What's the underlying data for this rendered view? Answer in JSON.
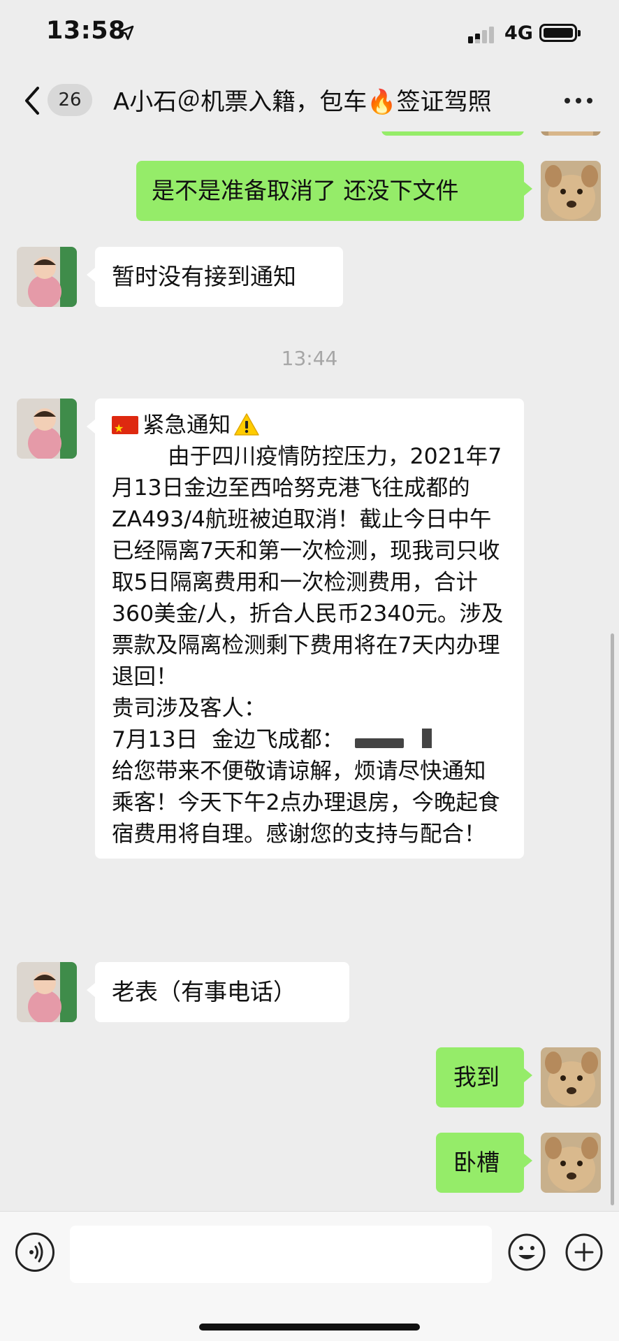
{
  "status_bar": {
    "time": "13:58",
    "network": "4G",
    "icons": [
      "location-arrow-icon",
      "cellular-signal-icon",
      "battery-icon"
    ]
  },
  "nav_bar": {
    "unread_count": "26",
    "title": "A小石＠机票入籍，包车🔥签证驾照",
    "icons": [
      "chevron-left-icon",
      "more-dots-icon"
    ]
  },
  "messages": [
    {
      "side": "out",
      "text": "是不是准备取消了 还没下文件"
    },
    {
      "side": "in",
      "text": "暂时没有接到通知"
    },
    {
      "type": "time",
      "text": "13:44"
    },
    {
      "side": "in",
      "title": "紧急通知",
      "body": [
        "        由于四川疫情防控压力，2021年7月13日金边至西哈努克港飞往成都的ZA493/4航班被迫取消！截止今日中午已经隔离7天和第一次检测，现我司只收取5日隔离费用和一次检测费用，合计360美金/人，折合人民币2340元。涉及票款及隔离检测剩下费用将在7天内办理退回！",
        "贵司涉及客人：",
        "7月13日  金边飞成都：",
        "给您带来不便敬请谅解，烦请尽快通知乘客！今天下午2点办理退房，今晚起食宿费用将自理。感谢您的支持与配合！"
      ]
    },
    {
      "side": "in",
      "text": "老表（有事电话）"
    },
    {
      "side": "out",
      "text": "我到"
    },
    {
      "side": "out",
      "text": "卧槽"
    }
  ],
  "input_bar": {
    "placeholder": "",
    "icons": [
      "voice-icon",
      "emoji-icon",
      "plus-icon"
    ]
  },
  "colors": {
    "background": "#ededed",
    "bubble_out": "#95ec69",
    "bubble_in": "#ffffff",
    "timestamp": "#a6a6a6"
  }
}
